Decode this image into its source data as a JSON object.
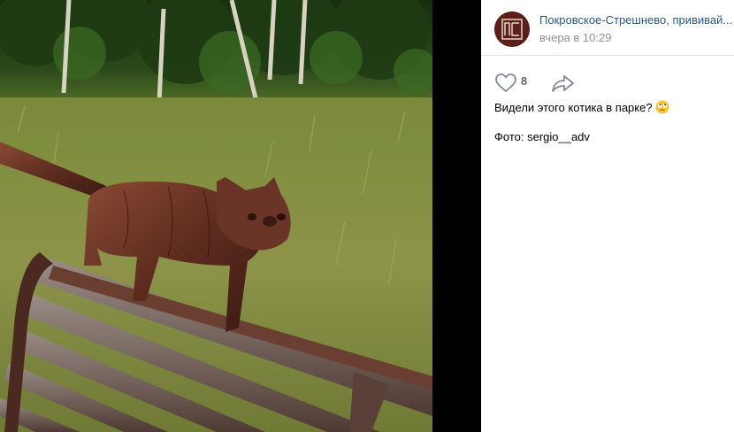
{
  "post": {
    "group_name": "Покровское-Стрешнево, прививай...",
    "time": "вчера в 10:29",
    "likes": "8",
    "text": "Видели этого котика в парке?",
    "credit": "Фото: sergio__adv"
  },
  "icons": {
    "like": "heart-outline-icon",
    "share": "share-arrow-icon",
    "emoji": "rolling-eyes-emoji"
  },
  "colors": {
    "link": "#2a5885",
    "meta": "#939393",
    "count": "#656565",
    "icon": "#828a99"
  }
}
